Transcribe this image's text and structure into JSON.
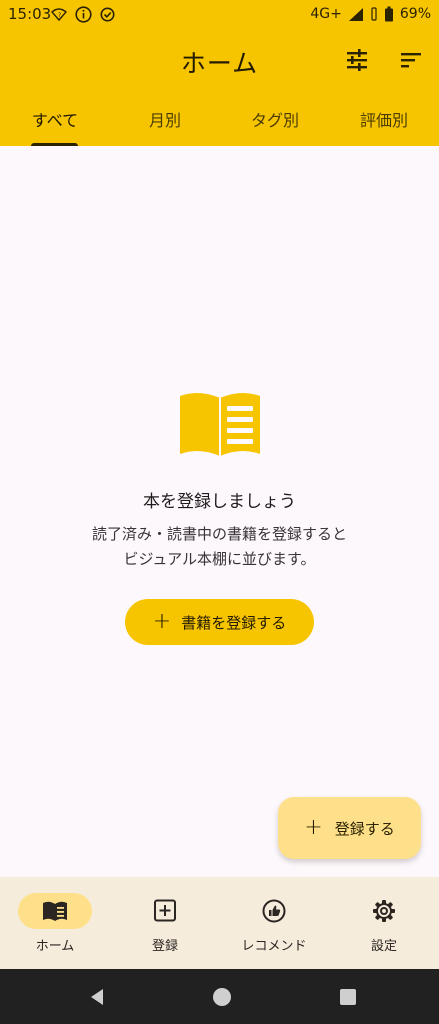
{
  "status_bar": {
    "time": "15:03",
    "network": "4G+",
    "battery": "69%",
    "icons": [
      "wifi-off-icon",
      "info-icon",
      "check-circle-icon",
      "signal-icon",
      "vibrate-icon",
      "battery-icon"
    ]
  },
  "header": {
    "title": "ホーム",
    "icons": [
      "tune-icon",
      "sort-icon"
    ]
  },
  "tabs": [
    {
      "label": "すべて",
      "active": true
    },
    {
      "label": "月別",
      "active": false
    },
    {
      "label": "タグ別",
      "active": false
    },
    {
      "label": "評価別",
      "active": false
    }
  ],
  "empty_state": {
    "icon": "open-book-icon",
    "title": "本を登録しましょう",
    "desc_line1": "読了済み・読書中の書籍を登録すると",
    "desc_line2": "ビジュアル本棚に並びます。",
    "button_label": "書籍を登録する"
  },
  "fab": {
    "label": "登録する",
    "icon": "plus-icon"
  },
  "bottom_nav": [
    {
      "label": "ホーム",
      "icon": "book-icon",
      "active": true
    },
    {
      "label": "登録",
      "icon": "add-box-icon",
      "active": false
    },
    {
      "label": "レコメンド",
      "icon": "recommend-icon",
      "active": false
    },
    {
      "label": "設定",
      "icon": "gear-icon",
      "active": false
    }
  ],
  "colors": {
    "accent": "#f7c500",
    "fab": "#ffe08a",
    "background": "#fdf8fb",
    "bottom_nav": "#f5ecdc",
    "system_nav": "#212121"
  }
}
